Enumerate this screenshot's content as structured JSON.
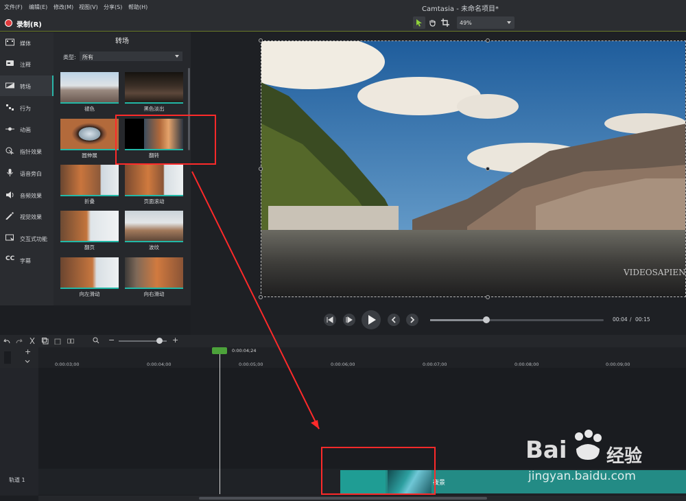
{
  "menu": [
    "文件(F)",
    "编辑(E)",
    "修改(M)",
    "视图(V)",
    "分享(S)",
    "帮助(H)"
  ],
  "title": "Camtasia - 未命名项目*",
  "record_label": "录制(R)",
  "zoom_value": "49%",
  "sidebar": {
    "items": [
      {
        "label": "媒体",
        "icon": "film-icon"
      },
      {
        "label": "注释",
        "icon": "annotation-icon"
      },
      {
        "label": "转场",
        "icon": "transition-icon"
      },
      {
        "label": "行为",
        "icon": "behavior-icon"
      },
      {
        "label": "动画",
        "icon": "animation-icon"
      },
      {
        "label": "指针效果",
        "icon": "cursor-icon"
      },
      {
        "label": "语音旁白",
        "icon": "microphone-icon"
      },
      {
        "label": "音频效果",
        "icon": "speaker-icon"
      },
      {
        "label": "视觉效果",
        "icon": "magic-wand-icon"
      },
      {
        "label": "交互式功能",
        "icon": "interactive-icon"
      },
      {
        "label": "字幕",
        "icon": "cc-icon"
      }
    ],
    "active_index": 2
  },
  "panel": {
    "title": "转场",
    "type_label": "类型:",
    "type_value": "所有",
    "tiles": [
      "褪色",
      "黑色淡出",
      "圆伸展",
      "翻转",
      "折叠",
      "页面滚动",
      "翻页",
      "波纹",
      "向左滑动",
      "向右滑动"
    ]
  },
  "preview": {
    "watermark": "VIDEOSAPIEN"
  },
  "player": {
    "current": "00:04",
    "total": "00:15",
    "progress": 0.32
  },
  "timeline": {
    "playhead_time": "0:00:04;24",
    "ticks": [
      "0:00:03;00",
      "0:00:04;00",
      "0:00:05;00",
      "0:00:06;00",
      "0:00:07;00",
      "0:00:08;00",
      "0:00:09;00"
    ],
    "track_label": "轨道 1",
    "clip_label": "夜景"
  },
  "watermark": {
    "brand": "Bai",
    "brand_cn": "经验",
    "url": "jingyan.baidu.com"
  },
  "colors": {
    "accent": "#22b8a7",
    "annotation": "#ff2a2a",
    "playhead": "#4ca23a"
  }
}
